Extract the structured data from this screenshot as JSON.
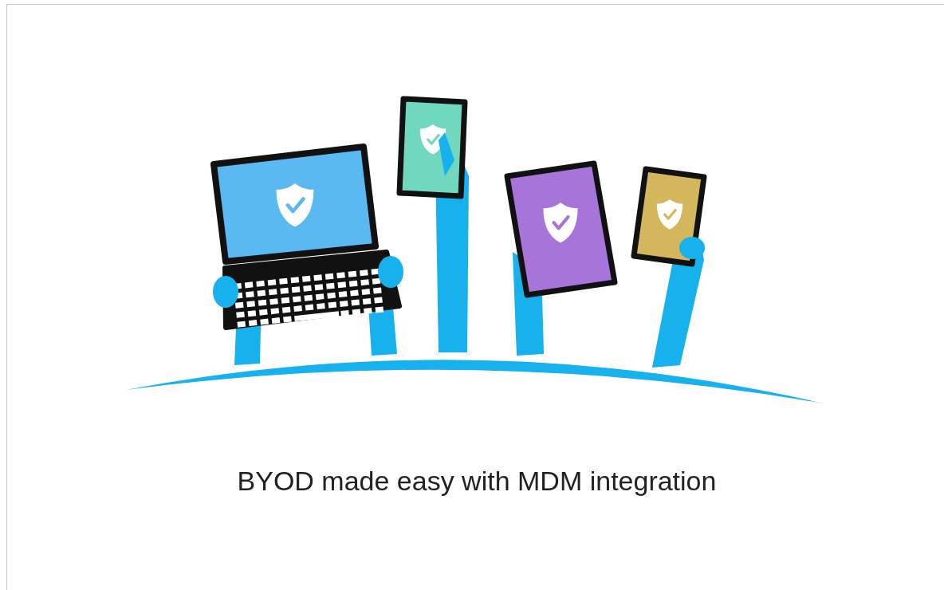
{
  "caption": "BYOD made easy with MDM integration"
}
